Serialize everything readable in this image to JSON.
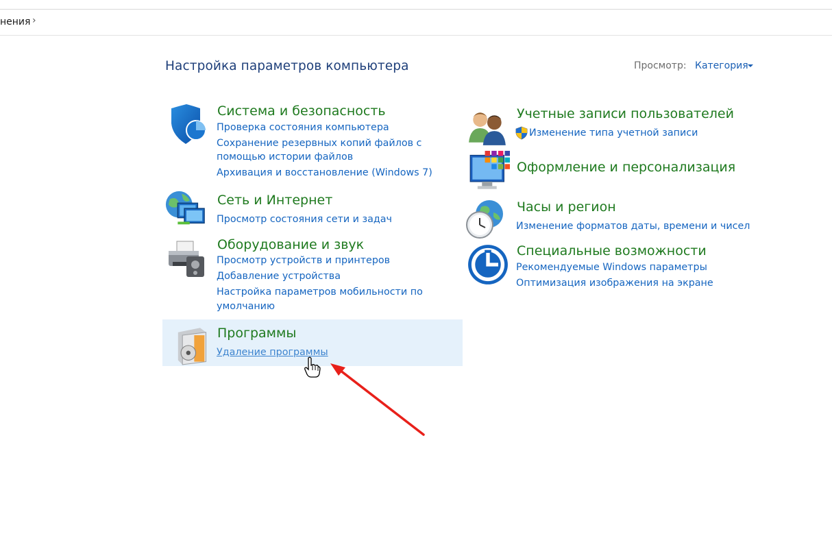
{
  "breadcrumb": {
    "fragment": "нения",
    "chevron": "›"
  },
  "header": {
    "title": "Настройка параметров компьютера",
    "view_label": "Просмотр:",
    "view_value": "Категория"
  },
  "categories": {
    "system": {
      "title": "Система и безопасность",
      "links": [
        "Проверка состояния компьютера",
        "Сохранение резервных копий файлов с",
        "помощью истории файлов",
        "Архивация и восстановление (Windows 7)"
      ]
    },
    "network": {
      "title": "Сеть и Интернет",
      "links": [
        "Просмотр состояния сети и задач"
      ]
    },
    "hardware": {
      "title": "Оборудование и звук",
      "links": [
        "Просмотр устройств и принтеров",
        "Добавление устройства",
        "Настройка параметров мобильности по",
        "умолчанию"
      ]
    },
    "programs": {
      "title": "Программы",
      "links": [
        "Удаление программы"
      ]
    },
    "accounts": {
      "title": "Учетные записи пользователей",
      "links": [
        "Изменение типа учетной записи"
      ]
    },
    "appearance": {
      "title": "Оформление и персонализация",
      "links": []
    },
    "clock": {
      "title": "Часы и регион",
      "links": [
        "Изменение форматов даты, времени и чисел"
      ]
    },
    "ease": {
      "title": "Специальные возможности",
      "links": [
        "Рекомендуемые Windows параметры",
        "Оптимизация изображения на экране"
      ]
    }
  },
  "annotation": {
    "arrow_color": "#e8201a",
    "cursor": "hand-pointer"
  }
}
